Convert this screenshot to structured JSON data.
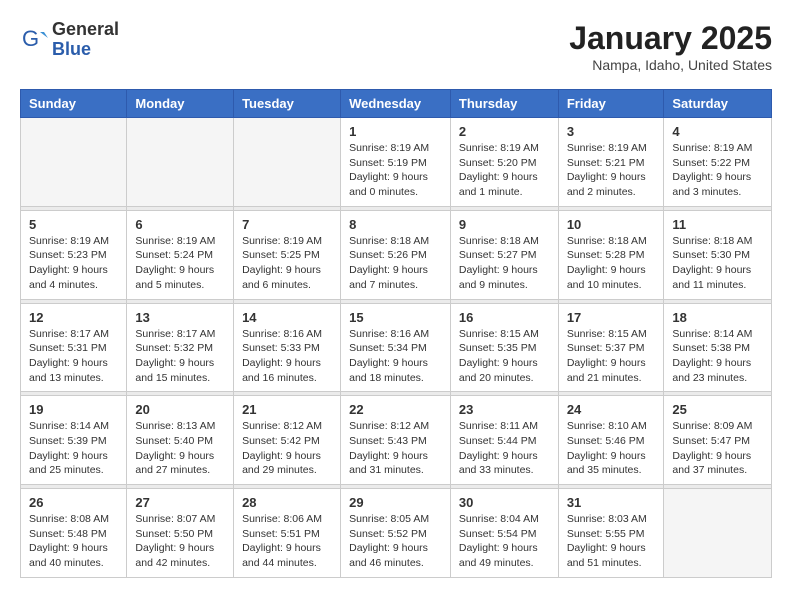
{
  "header": {
    "logo_general": "General",
    "logo_blue": "Blue",
    "month_title": "January 2025",
    "location": "Nampa, Idaho, United States"
  },
  "weekdays": [
    "Sunday",
    "Monday",
    "Tuesday",
    "Wednesday",
    "Thursday",
    "Friday",
    "Saturday"
  ],
  "weeks": [
    [
      {
        "day": "",
        "info": ""
      },
      {
        "day": "",
        "info": ""
      },
      {
        "day": "",
        "info": ""
      },
      {
        "day": "1",
        "info": "Sunrise: 8:19 AM\nSunset: 5:19 PM\nDaylight: 9 hours\nand 0 minutes."
      },
      {
        "day": "2",
        "info": "Sunrise: 8:19 AM\nSunset: 5:20 PM\nDaylight: 9 hours\nand 1 minute."
      },
      {
        "day": "3",
        "info": "Sunrise: 8:19 AM\nSunset: 5:21 PM\nDaylight: 9 hours\nand 2 minutes."
      },
      {
        "day": "4",
        "info": "Sunrise: 8:19 AM\nSunset: 5:22 PM\nDaylight: 9 hours\nand 3 minutes."
      }
    ],
    [
      {
        "day": "5",
        "info": "Sunrise: 8:19 AM\nSunset: 5:23 PM\nDaylight: 9 hours\nand 4 minutes."
      },
      {
        "day": "6",
        "info": "Sunrise: 8:19 AM\nSunset: 5:24 PM\nDaylight: 9 hours\nand 5 minutes."
      },
      {
        "day": "7",
        "info": "Sunrise: 8:19 AM\nSunset: 5:25 PM\nDaylight: 9 hours\nand 6 minutes."
      },
      {
        "day": "8",
        "info": "Sunrise: 8:18 AM\nSunset: 5:26 PM\nDaylight: 9 hours\nand 7 minutes."
      },
      {
        "day": "9",
        "info": "Sunrise: 8:18 AM\nSunset: 5:27 PM\nDaylight: 9 hours\nand 9 minutes."
      },
      {
        "day": "10",
        "info": "Sunrise: 8:18 AM\nSunset: 5:28 PM\nDaylight: 9 hours\nand 10 minutes."
      },
      {
        "day": "11",
        "info": "Sunrise: 8:18 AM\nSunset: 5:30 PM\nDaylight: 9 hours\nand 11 minutes."
      }
    ],
    [
      {
        "day": "12",
        "info": "Sunrise: 8:17 AM\nSunset: 5:31 PM\nDaylight: 9 hours\nand 13 minutes."
      },
      {
        "day": "13",
        "info": "Sunrise: 8:17 AM\nSunset: 5:32 PM\nDaylight: 9 hours\nand 15 minutes."
      },
      {
        "day": "14",
        "info": "Sunrise: 8:16 AM\nSunset: 5:33 PM\nDaylight: 9 hours\nand 16 minutes."
      },
      {
        "day": "15",
        "info": "Sunrise: 8:16 AM\nSunset: 5:34 PM\nDaylight: 9 hours\nand 18 minutes."
      },
      {
        "day": "16",
        "info": "Sunrise: 8:15 AM\nSunset: 5:35 PM\nDaylight: 9 hours\nand 20 minutes."
      },
      {
        "day": "17",
        "info": "Sunrise: 8:15 AM\nSunset: 5:37 PM\nDaylight: 9 hours\nand 21 minutes."
      },
      {
        "day": "18",
        "info": "Sunrise: 8:14 AM\nSunset: 5:38 PM\nDaylight: 9 hours\nand 23 minutes."
      }
    ],
    [
      {
        "day": "19",
        "info": "Sunrise: 8:14 AM\nSunset: 5:39 PM\nDaylight: 9 hours\nand 25 minutes."
      },
      {
        "day": "20",
        "info": "Sunrise: 8:13 AM\nSunset: 5:40 PM\nDaylight: 9 hours\nand 27 minutes."
      },
      {
        "day": "21",
        "info": "Sunrise: 8:12 AM\nSunset: 5:42 PM\nDaylight: 9 hours\nand 29 minutes."
      },
      {
        "day": "22",
        "info": "Sunrise: 8:12 AM\nSunset: 5:43 PM\nDaylight: 9 hours\nand 31 minutes."
      },
      {
        "day": "23",
        "info": "Sunrise: 8:11 AM\nSunset: 5:44 PM\nDaylight: 9 hours\nand 33 minutes."
      },
      {
        "day": "24",
        "info": "Sunrise: 8:10 AM\nSunset: 5:46 PM\nDaylight: 9 hours\nand 35 minutes."
      },
      {
        "day": "25",
        "info": "Sunrise: 8:09 AM\nSunset: 5:47 PM\nDaylight: 9 hours\nand 37 minutes."
      }
    ],
    [
      {
        "day": "26",
        "info": "Sunrise: 8:08 AM\nSunset: 5:48 PM\nDaylight: 9 hours\nand 40 minutes."
      },
      {
        "day": "27",
        "info": "Sunrise: 8:07 AM\nSunset: 5:50 PM\nDaylight: 9 hours\nand 42 minutes."
      },
      {
        "day": "28",
        "info": "Sunrise: 8:06 AM\nSunset: 5:51 PM\nDaylight: 9 hours\nand 44 minutes."
      },
      {
        "day": "29",
        "info": "Sunrise: 8:05 AM\nSunset: 5:52 PM\nDaylight: 9 hours\nand 46 minutes."
      },
      {
        "day": "30",
        "info": "Sunrise: 8:04 AM\nSunset: 5:54 PM\nDaylight: 9 hours\nand 49 minutes."
      },
      {
        "day": "31",
        "info": "Sunrise: 8:03 AM\nSunset: 5:55 PM\nDaylight: 9 hours\nand 51 minutes."
      },
      {
        "day": "",
        "info": ""
      }
    ]
  ]
}
